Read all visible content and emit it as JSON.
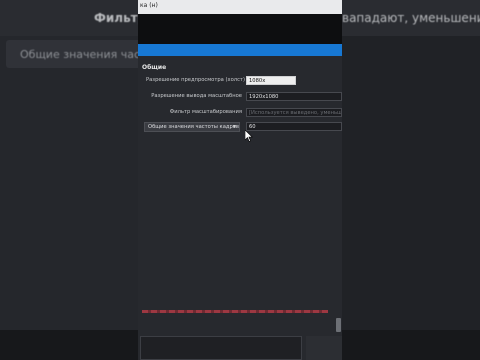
{
  "background": {
    "left_title": "Фильтр",
    "right_title": "вападают, уменьшение",
    "row_label": "Общие значения часто"
  },
  "window": {
    "title": "ка (н)",
    "group_title": "Общие",
    "rows": [
      {
        "label": "Разрешение предпросмотра (холст)",
        "value": "1080x"
      },
      {
        "label": "Разрешение вывода масштабное",
        "value": "1920x1080"
      },
      {
        "label": "Фильтр масштабирования",
        "value": "[Используется выведено, уменьшение)"
      }
    ],
    "fps_select": "Общие значения частоты кадров",
    "fps_value": "60"
  },
  "colors": {
    "accent": "#1778d4",
    "error": "#b23a45"
  }
}
